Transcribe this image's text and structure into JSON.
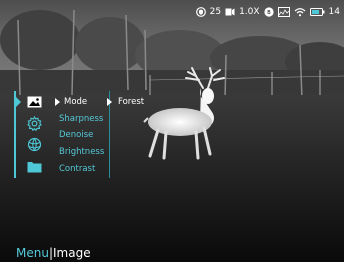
{
  "status": {
    "shield_value": "25",
    "zoom": "1.0X",
    "battery_value": "14",
    "icons": [
      "shield-icon",
      "recording-icon",
      "brightness-badge-icon",
      "palette-icon",
      "wifi-icon",
      "battery-icon"
    ]
  },
  "menu": {
    "icons": [
      "image-icon",
      "gear-icon",
      "globe-icon",
      "folder-icon"
    ],
    "items": [
      {
        "label": "Mode",
        "selected": true
      },
      {
        "label": "Sharpness",
        "selected": false
      },
      {
        "label": "Denoise",
        "selected": false
      },
      {
        "label": "Brightness",
        "selected": false
      },
      {
        "label": "Contrast",
        "selected": false
      }
    ],
    "submenu_value": "Forest"
  },
  "breadcrumb": {
    "root": "Menu",
    "separator": "|",
    "current": "Image"
  },
  "colors": {
    "accent": "#4ec8d6",
    "text": "#ffffff"
  }
}
